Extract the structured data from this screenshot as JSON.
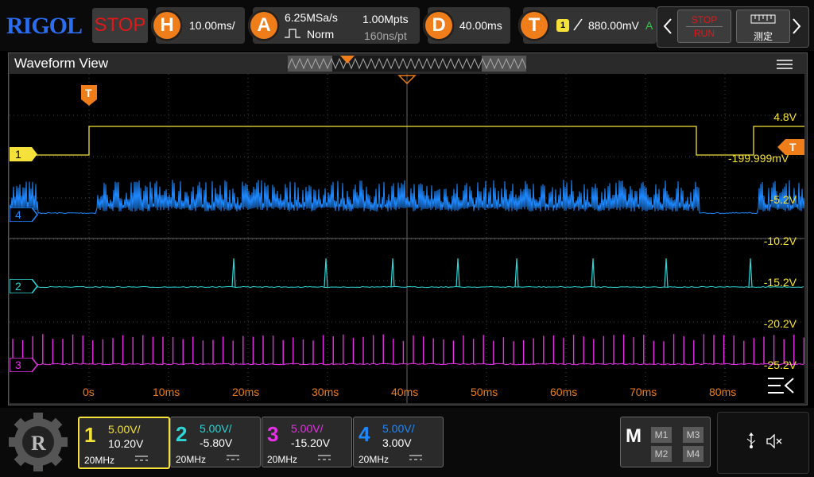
{
  "brand": "RIGOL",
  "run_state": "STOP",
  "horizontal": {
    "badge": "H",
    "timebase": "10.00ms/"
  },
  "acquire": {
    "badge": "A",
    "sample_rate": "6.25MSa/s",
    "mode": "Norm",
    "memory_depth": "1.00Mpts",
    "sample_interval": "160ns/pt"
  },
  "delay": {
    "badge": "D",
    "value": "40.00ms"
  },
  "trigger": {
    "badge": "T",
    "source": "1",
    "level": "880.00mV",
    "status": "A"
  },
  "controls": {
    "stop_label": "STOP",
    "run_label": "RUN",
    "measure_label": "测定"
  },
  "waveform_view": {
    "title": "Waveform View",
    "trigger_marker": "T",
    "volt_labels": [
      "4.8V",
      "-199.999mV",
      "-5.2V",
      "-10.2V",
      "-15.2V",
      "-20.2V",
      "-25.2V"
    ],
    "time_labels": [
      "0s",
      "10ms",
      "20ms",
      "30ms",
      "40ms",
      "50ms",
      "60ms",
      "70ms",
      "80ms"
    ],
    "channel_markers": [
      "1",
      "4",
      "2",
      "3"
    ]
  },
  "channels": [
    {
      "num": "1",
      "scale": "5.00V/",
      "offset": "10.20V",
      "bandwidth": "20MHz",
      "color": "#f4e23a"
    },
    {
      "num": "2",
      "scale": "5.00V/",
      "offset": "-5.80V",
      "bandwidth": "20MHz",
      "color": "#2fd6d6"
    },
    {
      "num": "3",
      "scale": "5.00V/",
      "offset": "-15.20V",
      "bandwidth": "20MHz",
      "color": "#e830e8"
    },
    {
      "num": "4",
      "scale": "5.00V/",
      "offset": "3.00V",
      "bandwidth": "20MHz",
      "color": "#1e88ff"
    }
  ],
  "math": {
    "label": "M",
    "buttons": [
      "M1",
      "M3",
      "M2",
      "M4"
    ]
  },
  "colors": {
    "accent": "#ee7d1a",
    "ch1": "#f4e23a",
    "ch2": "#2fd6d6",
    "ch3": "#e830e8",
    "ch4": "#1e88ff",
    "stop": "#e01818"
  },
  "icons": [
    "rigol-logo-icon",
    "usb-icon",
    "speaker-mute-icon",
    "menu-icon",
    "measure-ruler-icon",
    "chevron-left-icon",
    "chevron-right-icon"
  ]
}
